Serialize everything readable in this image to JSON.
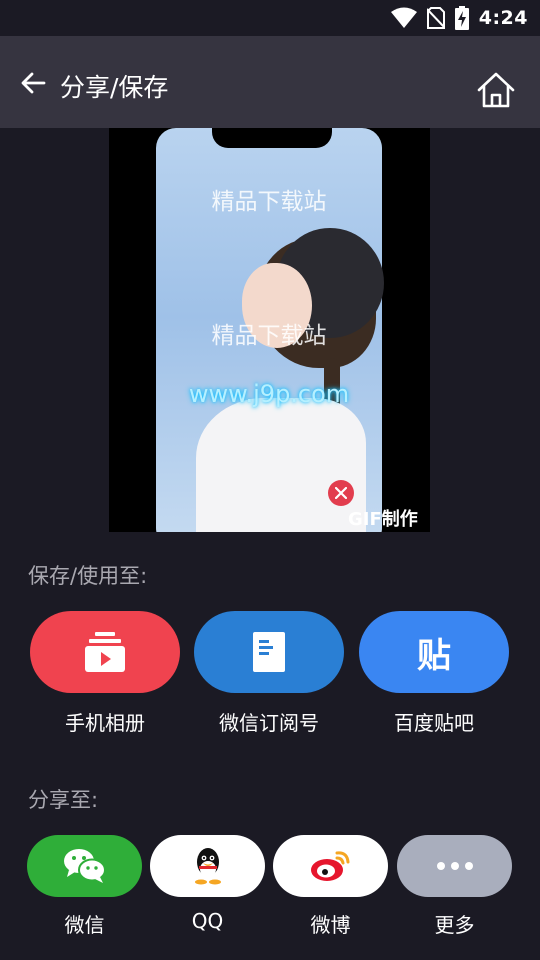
{
  "status_bar": {
    "time": "4:24",
    "icons": [
      "wifi-icon",
      "no-sim-icon",
      "battery-charging-icon"
    ]
  },
  "header": {
    "title": "分享/保存",
    "back_icon": "arrow-left-icon",
    "home_icon": "home-icon"
  },
  "preview": {
    "watermark_top": "精品下载站",
    "watermark_middle": "精品下载站",
    "watermark_url": "www.j9p.com",
    "gif_badge_prefix": "GIF",
    "gif_badge_suffix": "制作"
  },
  "save_section": {
    "label": "保存/使用至:",
    "targets": [
      {
        "label": "手机相册",
        "icon": "album-icon",
        "color": "#f0434f"
      },
      {
        "label": "微信订阅号",
        "icon": "document-icon",
        "color": "#2a7fd4"
      },
      {
        "label": "百度贴吧",
        "icon": "tieba-icon",
        "color": "#3a86f2",
        "icon_text": "贴"
      }
    ]
  },
  "share_section": {
    "label": "分享至:",
    "targets": [
      {
        "label": "微信",
        "icon": "wechat-icon",
        "color": "#2fae39"
      },
      {
        "label": "QQ",
        "icon": "qq-icon",
        "color": "#ffffff"
      },
      {
        "label": "微博",
        "icon": "weibo-icon",
        "color": "#ffffff"
      },
      {
        "label": "更多",
        "icon": "more-icon",
        "color": "#a9aebd"
      }
    ]
  }
}
